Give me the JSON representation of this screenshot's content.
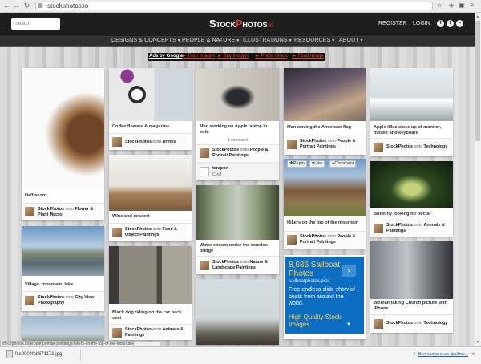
{
  "browser": {
    "url": "stockphotos.io",
    "status_url": "stockphotos.io/people-portrait-paintings/hikers-on-the-top-of-the-mountain/",
    "download_file": "file0004fcb671171.jpg",
    "download_show_all": "Все скачанные файлы..."
  },
  "header": {
    "search_placeholder": "Search",
    "logo_first": "S",
    "logo_mid": "TOCK",
    "logo_p": "P",
    "logo_rest": "HOTOS",
    "logo_tld": ".io",
    "register": "REGISTER",
    "login": "LOGIN",
    "social": [
      "f",
      "t",
      "≈"
    ]
  },
  "nav": {
    "items": [
      "DESIGNS & CONCEPTS",
      "PEOPLE & NATURE",
      "ILLUSTRATIONS",
      "RESOURCES",
      "ABOUT"
    ]
  },
  "ads_bar": {
    "label": "Ads by Google",
    "links": [
      "► Free Images",
      "► Buy Images",
      "► Photo Stock",
      "► Food Image"
    ]
  },
  "pins": [
    {
      "title": "Half acorn",
      "author": "StockPhotos",
      "onto": "onto",
      "board": "Flower & Plant Macro"
    },
    {
      "title": "Coffee flowers & magazine",
      "author": "StockPhotos",
      "onto": "onto",
      "board": "Drinks"
    },
    {
      "title": "Man working on Apple laptop in sofa",
      "comment": "1 comment",
      "author": "StockPhotos",
      "onto": "onto",
      "board": "People & Portrait Paintings",
      "commenter": "terapon",
      "comment_text": "Cool"
    },
    {
      "title": "Man waving the American flag",
      "author": "StockPhotos",
      "onto": "onto",
      "board": "People & Portrait Paintings"
    },
    {
      "title": "Apple iMac close up of monitor, mouse and keyboard",
      "author": "StockPhotos",
      "onto": "onto",
      "board": "Technology"
    },
    {
      "title": "Village, mountain, lake",
      "author": "StockPhotos",
      "onto": "onto",
      "board": "City View Photography"
    },
    {
      "title": "Wine and dessert",
      "author": "StockPhotos",
      "onto": "onto",
      "board": "Food & Object Paintings"
    },
    {
      "title": "Water stream under the wooden bridge",
      "author": "StockPhotos",
      "onto": "onto",
      "board": "Nature & Landscape Paintings"
    },
    {
      "title": "Hikers on the top of the mountain",
      "author": "StockPhotos",
      "onto": "onto",
      "board": "People & Portrait Paintings"
    },
    {
      "title": "Butterfly looking for nectar",
      "author": "StockPhotos",
      "onto": "onto",
      "board": "Animals & Paintings"
    },
    {
      "title": "Black dog riding on the car back seat",
      "author": "StockPhotos",
      "onto": "onto",
      "board": "Animals & Paintings"
    },
    {
      "title": "Woman taking Church picture with iPhone",
      "author": "StockPhotos",
      "onto": "onto",
      "board": "Technology"
    }
  ],
  "pin_actions": [
    "Repin",
    "Like",
    "Comment"
  ],
  "ad": {
    "title": "8,686 Sailboat Photos",
    "url": "sailboatphotos.pics",
    "body": "Free endless slide show of boats from around the world.",
    "cta": "High Quality Stock Images",
    "arrow": "›"
  },
  "colors": {
    "accent": "#e23a2b",
    "header_bg": "#1e1e1e",
    "ad_bg": "#0b6ec3"
  }
}
